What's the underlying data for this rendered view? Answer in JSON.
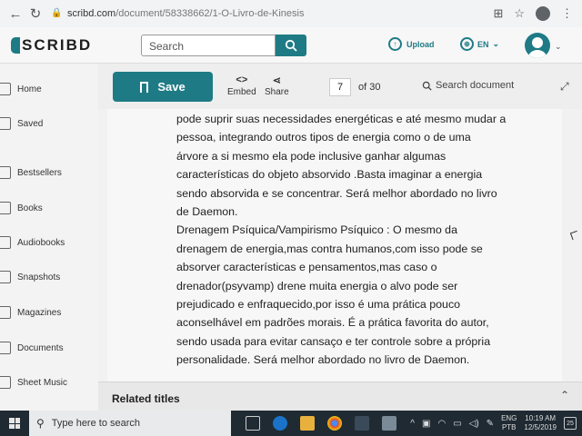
{
  "browser": {
    "url_host": "scribd.com",
    "url_path": "/document/58338662/1-O-Livro-de-Kinesis"
  },
  "header": {
    "logo": "SCRIBD",
    "search_placeholder": "Search",
    "upload_label": "Upload",
    "language": "EN"
  },
  "sidebar": {
    "items": [
      {
        "label": "Home"
      },
      {
        "label": "Saved"
      },
      {
        "label": "Bestsellers"
      },
      {
        "label": "Books"
      },
      {
        "label": "Audiobooks"
      },
      {
        "label": "Snapshots"
      },
      {
        "label": "Magazines"
      },
      {
        "label": "Documents"
      },
      {
        "label": "Sheet Music"
      }
    ]
  },
  "toolbar": {
    "save_label": "Save",
    "embed_label": "Embed",
    "share_label": "Share",
    "page_current": "7",
    "page_total": "of 30",
    "search_document": "Search document"
  },
  "document": {
    "lines": [
      "pode suprir suas necessidades energéticas e até mesmo mudar a",
      "pessoa, integrando outros tipos de energia como o de uma",
      "árvore a si mesmo ela pode inclusive ganhar algumas",
      "características do objeto absorvido .Basta imaginar a energia",
      "sendo absorvida e se concentrar. Será melhor abordado no livro",
      "de Daemon.",
      "Drenagem Psíquica/Vampirismo Psíquico : O mesmo da",
      "drenagem de energia,mas contra humanos,com isso pode se",
      "absorver características e pensamentos,mas caso o",
      "drenador(psyvamp) drene muita energia o alvo pode ser",
      "prejudicado e enfraquecido,por isso é uma prática pouco",
      "aconselhável em padrões morais. É a prática favorita do autor,",
      "sendo usada para evitar cansaço e ter controle sobre a própria",
      "personalidade. Será melhor abordado no livro de Daemon."
    ]
  },
  "related": {
    "title": "Related titles"
  },
  "taskbar": {
    "search_placeholder": "Type here to search",
    "lang_top": "ENG",
    "lang_bottom": "PTB",
    "time": "10:19 AM",
    "date": "12/5/2019",
    "notification_count": "25"
  }
}
